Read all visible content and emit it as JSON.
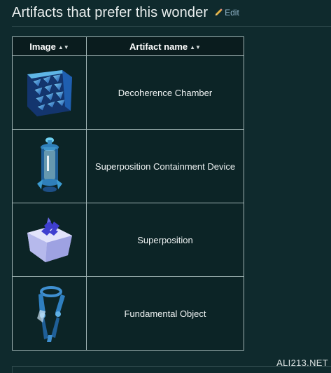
{
  "section": {
    "title": "Artifacts that prefer this wonder",
    "edit_label": "Edit"
  },
  "table": {
    "headers": [
      {
        "label": "Image",
        "sort_icon": "sort-both-icon"
      },
      {
        "label": "Artifact name",
        "sort_icon": "sort-both-icon"
      }
    ],
    "rows": [
      {
        "name": "Decoherence Chamber",
        "icon": "decoherence-chamber-icon"
      },
      {
        "name": "Superposition Containment Device",
        "icon": "superposition-containment-device-icon"
      },
      {
        "name": "Superposition",
        "icon": "superposition-icon"
      },
      {
        "name": "Fundamental Object",
        "icon": "fundamental-object-icon"
      }
    ]
  },
  "watermark": "ALI213.NET",
  "colors": {
    "background": "#0f2a2d",
    "table_background": "#0c2426",
    "border": "#9fb3b3",
    "edit_link": "#8fb3c8"
  }
}
